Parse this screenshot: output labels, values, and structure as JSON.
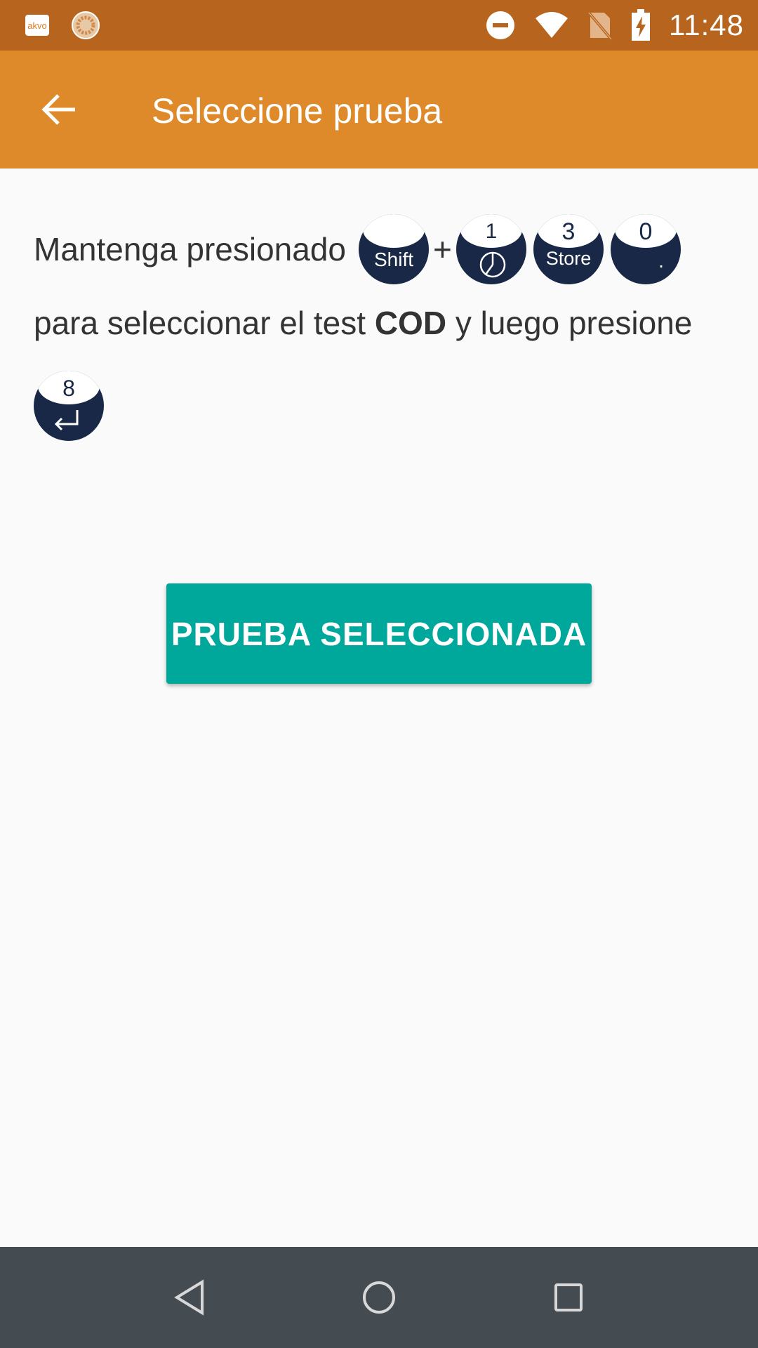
{
  "status_bar": {
    "app_badge": "akvo",
    "time": "11:48",
    "icons": [
      "akvo-app-icon",
      "sync-icon",
      "do-not-disturb-icon",
      "wifi-icon",
      "no-sim-icon",
      "battery-charging-icon"
    ]
  },
  "app_bar": {
    "title": "Seleccione prueba",
    "back_icon": "arrow-left-icon"
  },
  "instructions": {
    "part1": "Mantenga presionado",
    "plus": "+",
    "part2": "para seleccionar el test",
    "test_code": "COD",
    "part3": "y luego presione",
    "keys": {
      "shift": {
        "top": "",
        "bottom": "Shift"
      },
      "one": {
        "top": "1",
        "bottom": "clock-icon"
      },
      "three": {
        "top": "3",
        "bottom": "Store"
      },
      "zero": {
        "top": "0",
        "bottom": "."
      },
      "eight": {
        "top": "8",
        "bottom": "enter-icon"
      }
    }
  },
  "primary_button": {
    "label": "PRUEBA SELECCIONADA",
    "color": "#00a89c"
  },
  "nav_bar": {
    "icons": [
      "back-triangle-icon",
      "home-circle-icon",
      "recents-square-icon"
    ]
  },
  "colors": {
    "status_bar": "#b7651e",
    "app_bar": "#de8a2b",
    "key_fill": "#182846",
    "nav_bar": "#444c52"
  }
}
